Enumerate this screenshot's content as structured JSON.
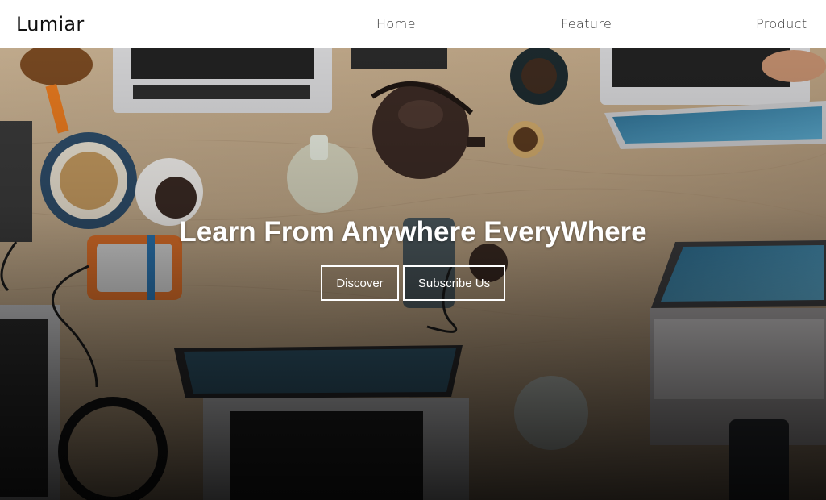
{
  "brand": {
    "name": "Lumiar"
  },
  "nav": {
    "home": "Home",
    "feature": "Feature",
    "product": "Product"
  },
  "hero": {
    "title": "Learn From Anywhere EveryWhere",
    "discover_label": "Discover",
    "subscribe_label": "Subscribe Us",
    "background_icon": "desk-with-laptops-photo"
  },
  "colors": {
    "navbar_bg": "#ffffff",
    "hero_text": "#ffffff",
    "button_border": "#ffffff",
    "wood": "#c4ab8a"
  }
}
